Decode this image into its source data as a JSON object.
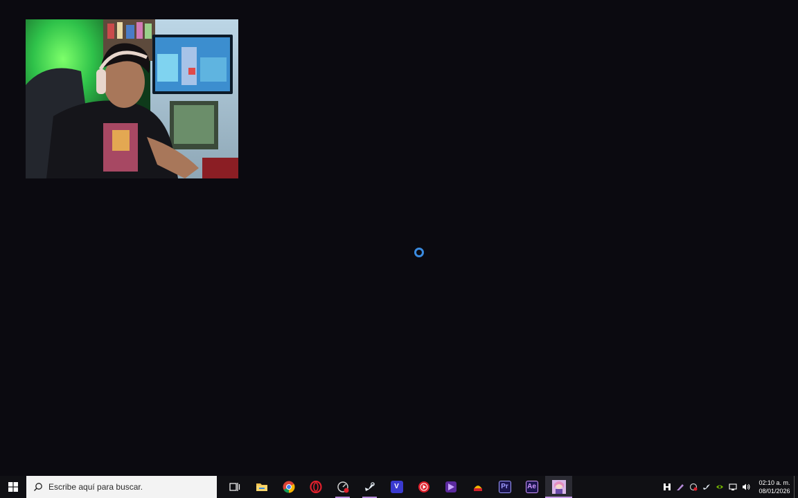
{
  "desktop": {
    "webcam_label": "webcam-feed",
    "accent_color": "#3a8be0"
  },
  "taskbar": {
    "search": {
      "placeholder": "Escribe aquí para buscar."
    },
    "apps": [
      {
        "name": "task-view",
        "icon": "task-view-icon"
      },
      {
        "name": "file-explorer",
        "icon": "folder-icon"
      },
      {
        "name": "chrome",
        "icon": "chrome-icon"
      },
      {
        "name": "opera-gx",
        "icon": "opera-icon"
      },
      {
        "name": "recorder",
        "icon": "record-gauge-icon",
        "running": true
      },
      {
        "name": "steam",
        "icon": "steam-icon",
        "running": true
      },
      {
        "name": "vegas",
        "icon": "v-icon",
        "label": "V"
      },
      {
        "name": "youtube-music",
        "icon": "play-icon"
      },
      {
        "name": "app-purple",
        "icon": "purple-app-icon"
      },
      {
        "name": "app-emblem",
        "icon": "emblem-icon"
      },
      {
        "name": "premiere-pro",
        "icon": "premiere-icon",
        "label": "Pr"
      },
      {
        "name": "after-effects",
        "icon": "after-effects-icon",
        "label": "Ae"
      },
      {
        "name": "anime-app",
        "icon": "anime-app-icon",
        "active": true
      }
    ],
    "clock": {
      "time": "02:10 a. m.",
      "date": "08/01/2026"
    }
  }
}
